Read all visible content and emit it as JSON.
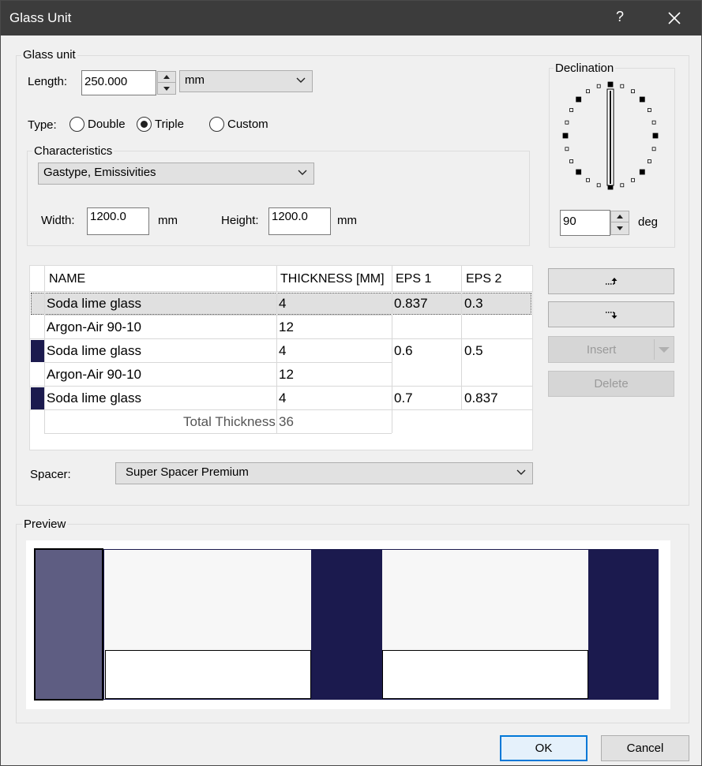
{
  "window": {
    "title": "Glass Unit",
    "help_symbol": "?"
  },
  "glass_unit": {
    "group_label": "Glass unit",
    "length_label": "Length:",
    "length_value": "250.000",
    "length_unit": "mm",
    "type_label": "Type:",
    "type_options": [
      "Double",
      "Triple",
      "Custom"
    ],
    "type_selected": "Triple"
  },
  "characteristics": {
    "group_label": "Characteristics",
    "mode": "Gastype, Emissivities",
    "width_label": "Width:",
    "width_value": "1200.0",
    "width_unit": "mm",
    "height_label": "Height:",
    "height_value": "1200.0",
    "height_unit": "mm"
  },
  "declination": {
    "group_label": "Declination",
    "value": "90",
    "unit": "deg"
  },
  "layers": {
    "headers": [
      "NAME",
      "THICKNESS [MM]",
      "EPS 1",
      "EPS 2"
    ],
    "rows": [
      {
        "name": "Soda lime glass",
        "thickness": "4",
        "eps1": "0.837",
        "eps2": "0.3"
      },
      {
        "name": "Argon-Air 90-10",
        "thickness": "12",
        "eps1": "",
        "eps2": ""
      },
      {
        "name": "Soda lime glass",
        "thickness": "4",
        "eps1": "0.6",
        "eps2": "0.5"
      },
      {
        "name": "Argon-Air 90-10",
        "thickness": "12",
        "eps1": "",
        "eps2": ""
      },
      {
        "name": "Soda lime glass",
        "thickness": "4",
        "eps1": "0.7",
        "eps2": "0.837"
      }
    ],
    "total_label": "Total Thickness",
    "total_value": "36",
    "selected_row": 0
  },
  "side_buttons": {
    "move_up_icon": "move-up-arrow-icon",
    "move_down_icon": "move-down-arrow-icon",
    "insert": "Insert",
    "delete": "Delete"
  },
  "spacer": {
    "label": "Spacer:",
    "value": "Super Spacer Premium"
  },
  "preview": {
    "group_label": "Preview"
  },
  "footer": {
    "ok": "OK",
    "cancel": "Cancel"
  },
  "colors": {
    "glass_selected": "#5e5d82",
    "glass": "#1b1a4e",
    "gas": "#f7f7f7",
    "accent": "#0078d7"
  }
}
